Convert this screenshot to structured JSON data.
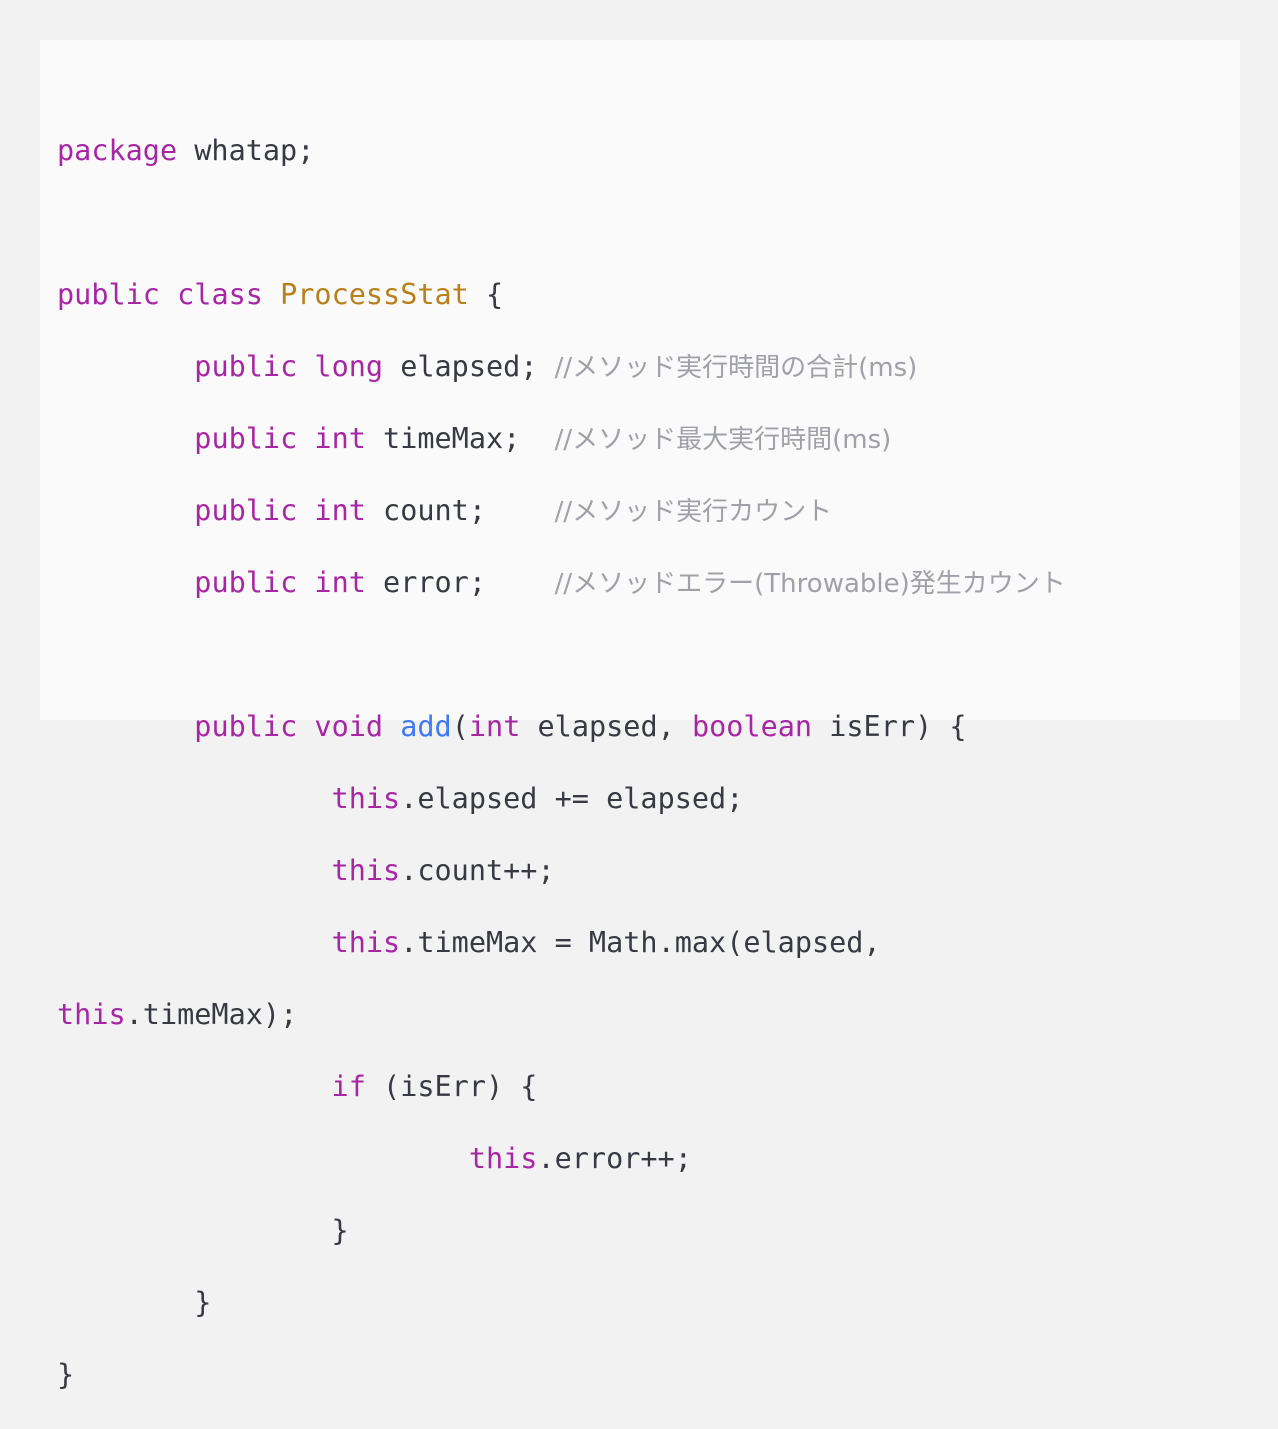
{
  "snippet": {
    "package_kw": "package",
    "package_rest": " whatap;",
    "public_kw": "public",
    "class_kw": "class",
    "class_name": "ProcessStat",
    "open_brace": " {",
    "indent1": "        ",
    "indent2": "                ",
    "indent3": "                        ",
    "long_kw": "long",
    "int_kw": "int",
    "void_kw": "void",
    "boolean_kw": "boolean",
    "this_kw": "this",
    "if_kw": "if",
    "method_name": "add",
    "field_elapsed": " elapsed; ",
    "field_timemax": " timeMax;  ",
    "field_count": " count;    ",
    "field_error": " error;    ",
    "comment_elapsed": "//メソッド実行時間の合計(ms)",
    "comment_timemax": "//メソッド最大実行時間(ms)",
    "comment_count": "//メソッド実行カウント",
    "comment_error": "//メソッドエラー(Throwable)発生カウント",
    "method_params_open": "(",
    "method_params_mid": " elapsed, ",
    "method_params_close": " isErr) {",
    "stmt_elapsed": ".elapsed += elapsed;",
    "stmt_count": ".count++;",
    "stmt_timemax_a": ".timeMax = Math.max(elapsed,",
    "stmt_timemax_b": ".timeMax);",
    "if_cond": " (isErr) {",
    "stmt_error": ".error++;",
    "close_brace": "}"
  }
}
